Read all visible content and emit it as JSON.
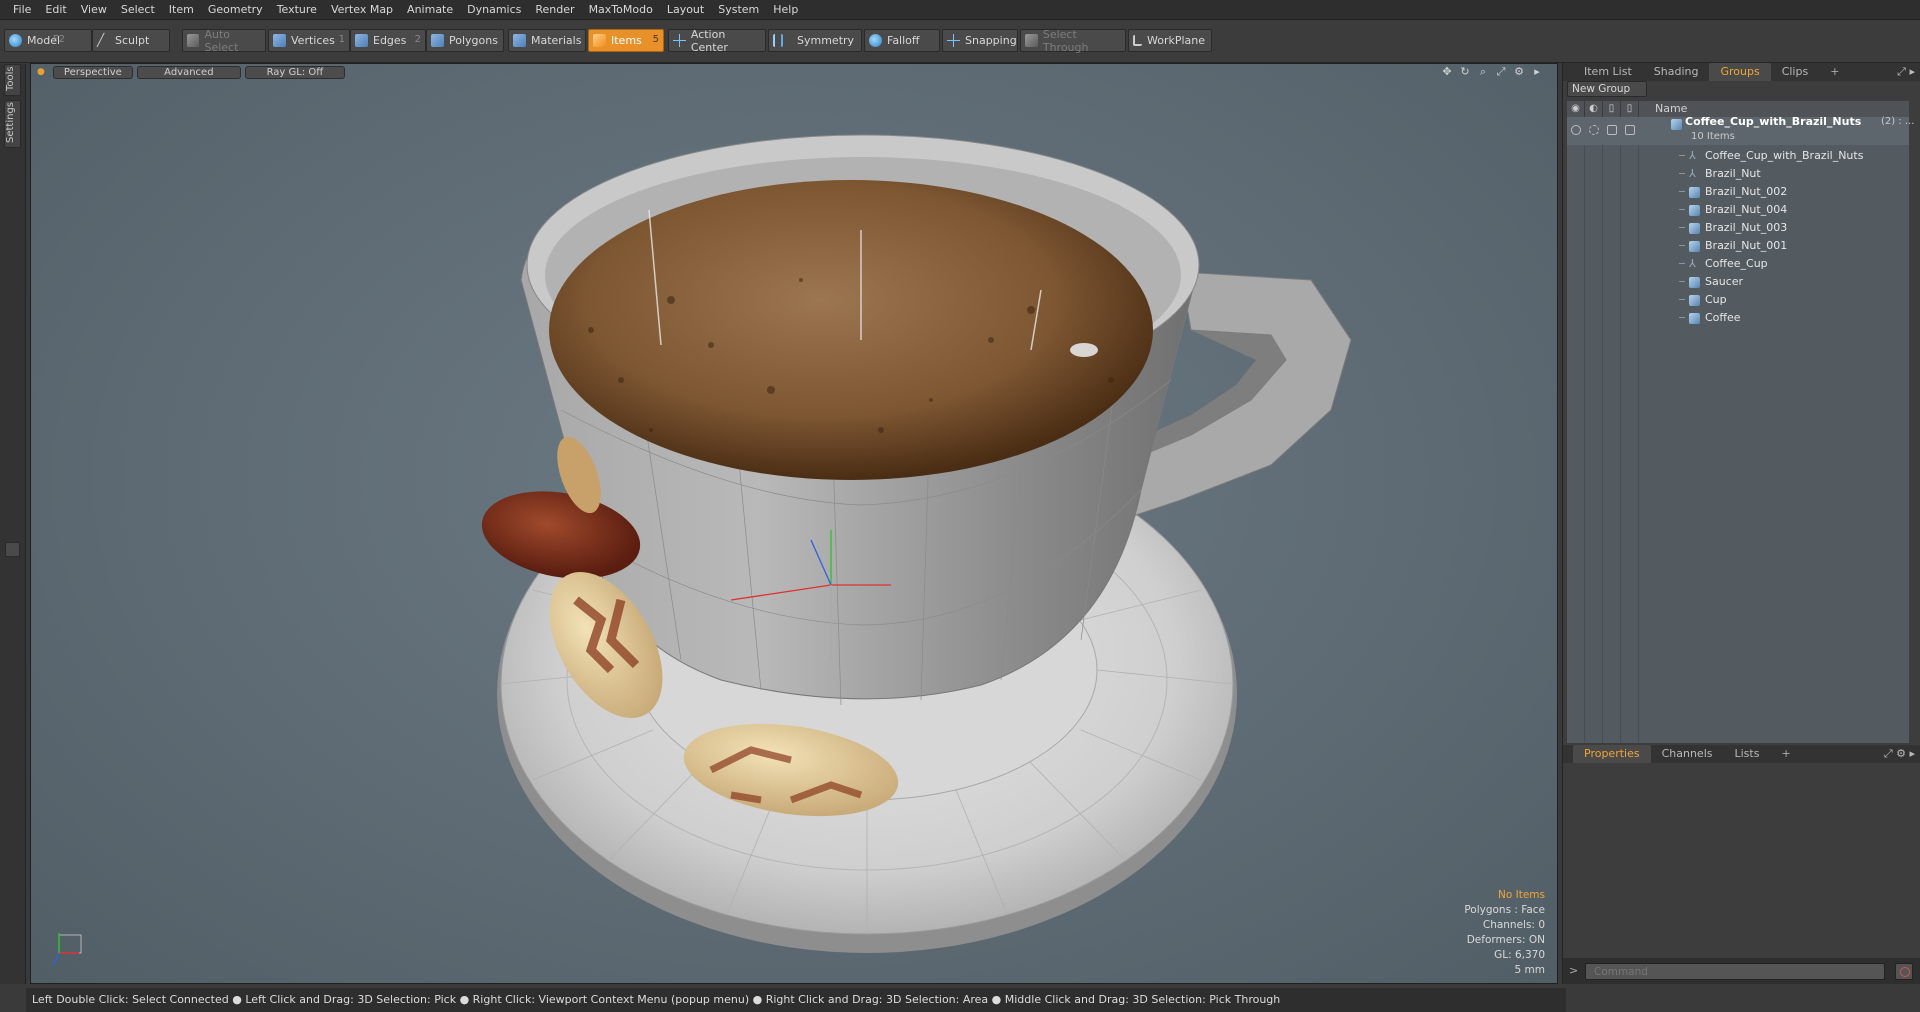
{
  "menubar": {
    "items": [
      "File",
      "Edit",
      "View",
      "Select",
      "Item",
      "Geometry",
      "Texture",
      "Vertex Map",
      "Animate",
      "Dynamics",
      "Render",
      "MaxToModo",
      "Layout",
      "System",
      "Help"
    ]
  },
  "toolbar": {
    "model_label": "Model",
    "model_key": "F2",
    "sculpt_label": "Sculpt",
    "auto_select_label": "Auto Select",
    "vertices_label": "Vertices",
    "vertices_key": "1",
    "edges_label": "Edges",
    "edges_key": "2",
    "polygons_label": "Polygons",
    "materials_label": "Materials",
    "items_label": "Items",
    "items_key": "5",
    "action_center_label": "Action Center",
    "symmetry_label": "Symmetry",
    "falloff_label": "Falloff",
    "snapping_label": "Snapping",
    "select_through_label": "Select Through",
    "workplane_label": "WorkPlane"
  },
  "left_strip": {
    "tools_label": "Tools",
    "settings_label": "Settings"
  },
  "viewport": {
    "view_mode": "Perspective",
    "shading_mode": "Advanced",
    "raygl": "Ray GL: Off",
    "info": {
      "selection": "No Items",
      "polygons": "Polygons : Face",
      "channels": "Channels: 0",
      "deformers": "Deformers: ON",
      "gl": "GL: 6,370",
      "scale": "5 mm"
    }
  },
  "status_bar": {
    "text": "Left Double Click: Select Connected ● Left Click and Drag: 3D Selection: Pick ● Right Click: Viewport Context Menu (popup menu) ● Right Click and Drag: 3D Selection: Area ● Middle Click and Drag: 3D Selection: Pick Through"
  },
  "right_panel": {
    "tabs": [
      "Item List",
      "Shading",
      "Groups",
      "Clips"
    ],
    "active_tab": "Groups",
    "new_group_label": "New Group",
    "name_header": "Name",
    "root_group": {
      "name": "Coffee_Cup_with_Brazil_Nuts",
      "suffix": "(2) : ...",
      "count": "10 Items"
    },
    "items": [
      {
        "name": "Coffee_Cup_with_Brazil_Nuts",
        "icon": "locator-icon"
      },
      {
        "name": "Brazil_Nut",
        "icon": "locator-icon"
      },
      {
        "name": "Brazil_Nut_002",
        "icon": "mesh-icon"
      },
      {
        "name": "Brazil_Nut_004",
        "icon": "mesh-icon"
      },
      {
        "name": "Brazil_Nut_003",
        "icon": "mesh-icon"
      },
      {
        "name": "Brazil_Nut_001",
        "icon": "mesh-icon"
      },
      {
        "name": "Coffee_Cup",
        "icon": "locator-icon"
      },
      {
        "name": "Saucer",
        "icon": "mesh-icon"
      },
      {
        "name": "Cup",
        "icon": "mesh-icon"
      },
      {
        "name": "Coffee",
        "icon": "mesh-icon"
      }
    ],
    "bottom_tabs": [
      "Properties",
      "Channels",
      "Lists"
    ],
    "bottom_active": "Properties",
    "command_placeholder": "Command"
  },
  "colors": {
    "accent": "#e8912a",
    "active_tab_text": "#f0a533"
  }
}
